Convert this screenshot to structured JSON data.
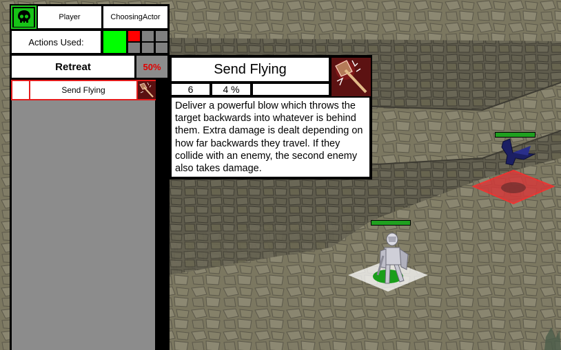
{
  "hud": {
    "faction_icon": "skull-icon",
    "player_label": "Player",
    "state_label": "ChoosingActor",
    "actions_label": "Actions Used:",
    "action_slots": [
      {
        "status": "used",
        "color": "#ff0000"
      },
      {
        "status": "empty",
        "color": "#808080"
      },
      {
        "status": "empty",
        "color": "#808080"
      },
      {
        "status": "empty",
        "color": "#808080"
      },
      {
        "status": "empty",
        "color": "#808080"
      },
      {
        "status": "empty",
        "color": "#808080"
      }
    ],
    "current_actor_color": "#00ff00"
  },
  "abilities": {
    "retreat": {
      "label": "Retreat",
      "chance": "50%"
    },
    "list": [
      {
        "name": "Send Flying",
        "icon": "hammer-icon"
      }
    ]
  },
  "tooltip": {
    "title": "Send Flying",
    "icon": "hammer-icon",
    "stat_1": "6",
    "stat_2": "4 %",
    "stat_3": "",
    "description": "Deliver a powerful blow which throws the target backwards into whatever is behind them. Extra damage is dealt depending on how far backwards they travel. If they collide with an enemy, the second enemy also takes damage."
  },
  "units": {
    "player_unit": {
      "health_fraction": 1.0,
      "tile_color": "#1a9e1a",
      "sprite": "armored-knight"
    },
    "enemy_unit": {
      "health_fraction": 1.0,
      "tile_color": "#d33a3a",
      "sprite": "dark-winged-creature"
    }
  },
  "colors": {
    "accent_red": "#ff0000",
    "retreat_chance": "#e00000",
    "health_bar": "#1fa01f",
    "panel_gray": "#8c8c8c",
    "dark_strip": "#000000"
  }
}
